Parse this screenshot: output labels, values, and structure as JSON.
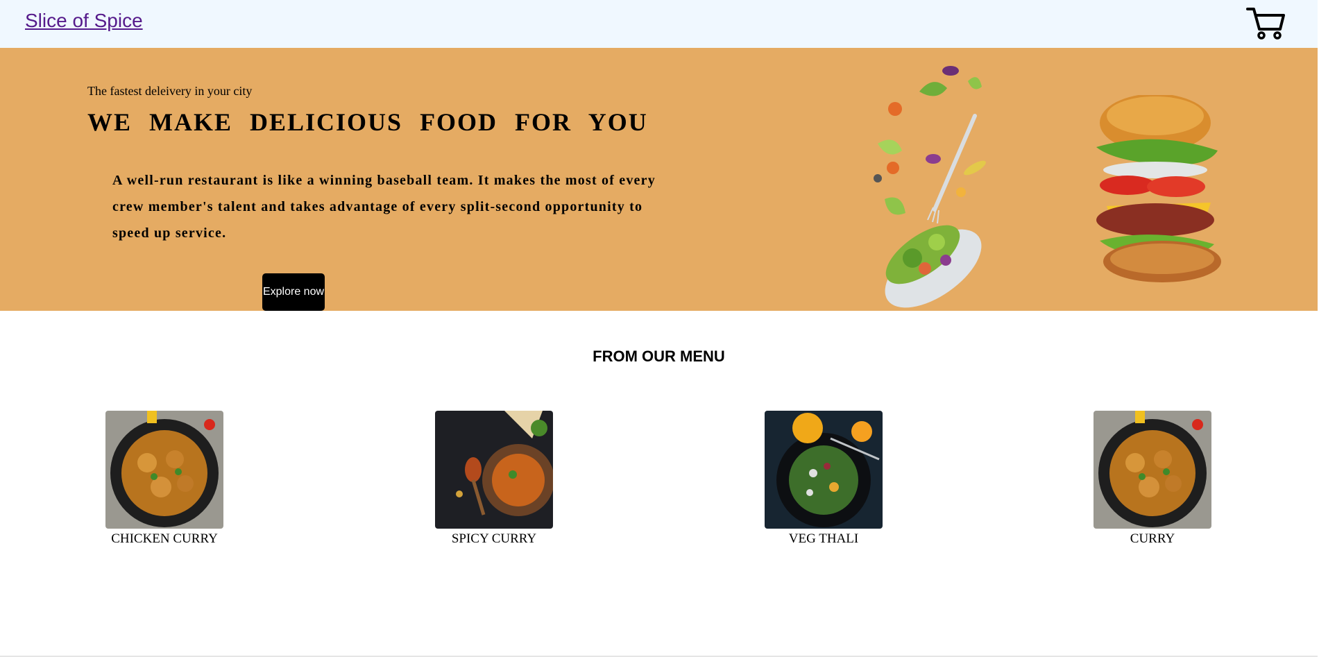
{
  "navbar": {
    "brand": "Slice of Spice",
    "cart_icon": "cart-icon"
  },
  "hero": {
    "tagline": "The fastest deleivery in your city",
    "headline": "WE MAKE DELICIOUS FOOD FOR YOU",
    "quote": "A well-run restaurant is like a winning baseball team. It makes the most of every crew member's talent and takes advantage of every split-second opportunity to speed up service.",
    "cta_label": "Explore now",
    "background_color": "#e5ab63"
  },
  "menu": {
    "title": "FROM OUR MENU",
    "items": [
      {
        "label": "CHICKEN CURRY"
      },
      {
        "label": "SPICY CURRY"
      },
      {
        "label": "VEG THALI"
      },
      {
        "label": "CURRY"
      }
    ]
  }
}
